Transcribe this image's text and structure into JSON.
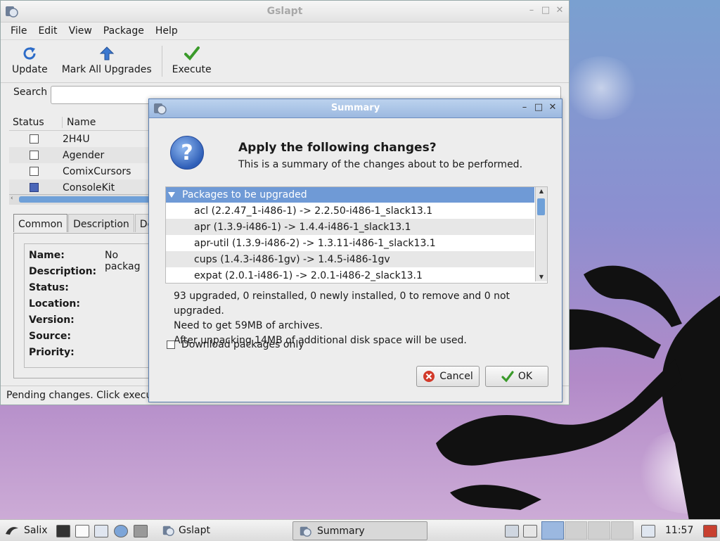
{
  "main_window": {
    "title": "Gslapt",
    "menu": [
      "File",
      "Edit",
      "View",
      "Package",
      "Help"
    ],
    "toolbar": {
      "update_label": "Update",
      "mark_all_label": "Mark All Upgrades",
      "execute_label": "Execute"
    },
    "search": {
      "label": "Search",
      "value": ""
    },
    "table": {
      "headers": [
        "Status",
        "Name"
      ],
      "rows": [
        {
          "name": "2H4U",
          "status": "not-installed"
        },
        {
          "name": "Agender",
          "status": "not-installed"
        },
        {
          "name": "ComixCursors",
          "status": "not-installed"
        },
        {
          "name": "ConsoleKit",
          "status": "installed"
        }
      ]
    },
    "tabs": [
      "Common",
      "Description",
      "Dep"
    ],
    "details": {
      "name_label": "Name:",
      "name_value": "No packag",
      "description_label": "Description:",
      "status_label": "Status:",
      "location_label": "Location:",
      "version_label": "Version:",
      "source_label": "Source:",
      "priority_label": "Priority:"
    },
    "status_text": "Pending changes. Click execut"
  },
  "dialog": {
    "title": "Summary",
    "heading": "Apply the following changes?",
    "subheading": "This is a summary of the changes about to be performed.",
    "group_label": "Packages to be upgraded",
    "packages": [
      "acl (2.2.47_1-i486-1) -> 2.2.50-i486-1_slack13.1",
      "apr (1.3.9-i486-1) -> 1.4.4-i486-1_slack13.1",
      "apr-util (1.3.9-i486-2) -> 1.3.11-i486-1_slack13.1",
      "cups (1.4.3-i486-1gv) -> 1.4.5-i486-1gv",
      "expat (2.0.1-i486-1) -> 2.0.1-i486-2_slack13.1"
    ],
    "summary_line1": "93 upgraded, 0 reinstalled, 0 newly installed, 0 to remove and 0 not upgraded.",
    "summary_line2": "Need to get 59MB of archives.",
    "summary_line3": "After unpacking 14MB of additional disk space will be used.",
    "download_only_label": "Download packages only",
    "download_only_checked": false,
    "cancel_label": "Cancel",
    "ok_label": "OK"
  },
  "taskbar": {
    "start_label": "Salix",
    "task_gslapt": "Gslapt",
    "task_summary": "Summary",
    "clock": "11:57"
  },
  "colors": {
    "accent": "#6f9ad6",
    "dialog_title": "#9cb9e0",
    "cancel_red": "#d23a2a",
    "ok_green": "#3a9a2a"
  }
}
